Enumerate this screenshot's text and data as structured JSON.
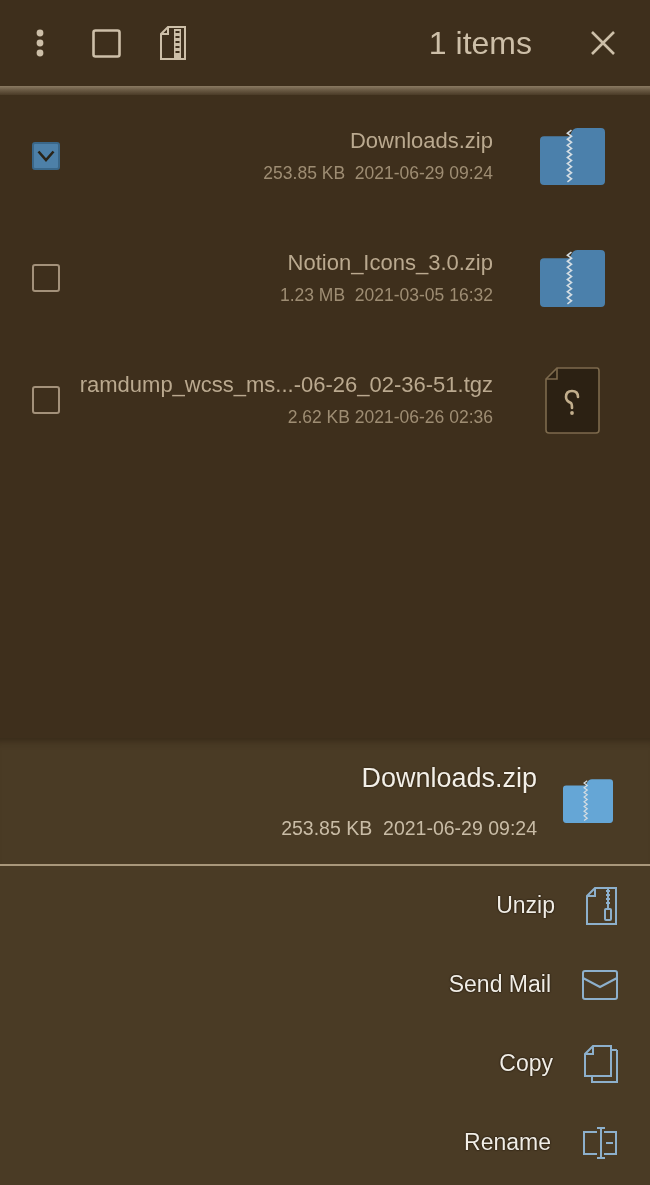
{
  "toolbar": {
    "title": "1 items"
  },
  "files": [
    {
      "name": "Downloads.zip",
      "details": "253.85 KB  2021-06-29 09:24",
      "kind": "zip",
      "checked": true
    },
    {
      "name": "Notion_Icons_3.0.zip",
      "details": "1.23 MB  2021-03-05 16:32",
      "kind": "zip",
      "checked": false
    },
    {
      "name": "ramdump_wcss_ms...-06-26_02-36-51.tgz",
      "details": "2.62 KB 2021-06-26 02:36",
      "kind": "unknown",
      "checked": false
    }
  ],
  "bottom_sheet": {
    "file": {
      "name": "Downloads.zip",
      "details": "253.85 KB  2021-06-29 09:24",
      "kind": "zip"
    },
    "actions": [
      {
        "label": "Unzip",
        "kind": "unzip"
      },
      {
        "label": "Send Mail",
        "kind": "mail"
      },
      {
        "label": "Copy",
        "kind": "copy"
      },
      {
        "label": "Rename",
        "kind": "rename"
      }
    ]
  }
}
